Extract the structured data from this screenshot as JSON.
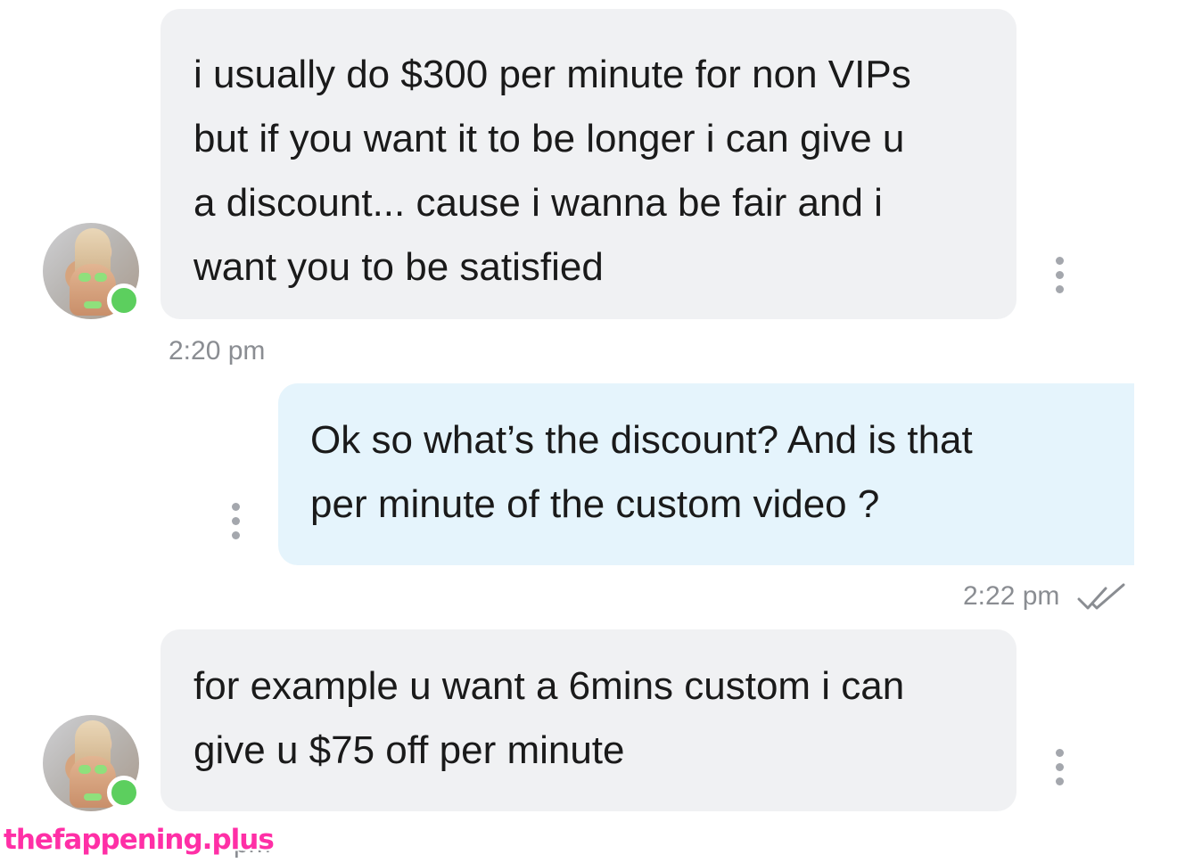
{
  "messages": [
    {
      "direction": "incoming",
      "lines": [
        "i usually do $300 per minute for non VIPs",
        "but if you want it to be longer i can give u",
        "a discount... cause i wanna be fair and i",
        "want you to be satisfied"
      ],
      "time": "2:20 pm",
      "sender_online": true
    },
    {
      "direction": "outgoing",
      "lines": [
        "Ok so what’s the discount? And is that",
        "per minute of the custom video ?"
      ],
      "time": "2:22 pm",
      "status_icon": "double-check-icon"
    },
    {
      "direction": "incoming",
      "lines": [
        "for example u want a 6mins custom i can",
        "give u $75 off per minute"
      ],
      "time": "pm",
      "sender_online": true
    }
  ],
  "watermark": "thefappening.plus",
  "colors": {
    "incoming_bubble": "#f0f1f3",
    "outgoing_bubble": "#e5f4fc",
    "online_dot": "#5ccf5e",
    "timestamp": "#8a8d92",
    "watermark": "#ff2fa6"
  }
}
